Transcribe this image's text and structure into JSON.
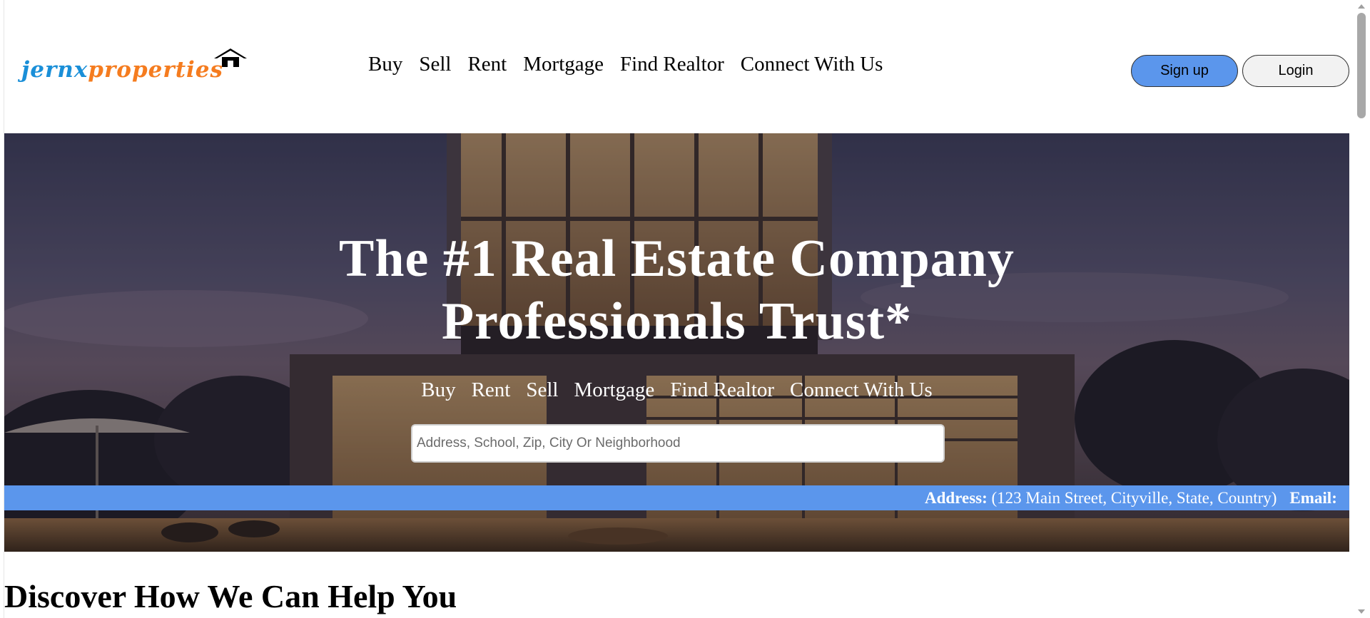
{
  "header": {
    "logo": {
      "part1": "jernx",
      "part2": "properties"
    },
    "nav": [
      "Buy",
      "Sell",
      "Rent",
      "Mortgage",
      "Find Realtor",
      "Connect With Us"
    ],
    "signup_label": "Sign up",
    "login_label": "Login"
  },
  "hero": {
    "title_line1": "The #1 Real Estate Company",
    "title_line2": "Professionals Trust*",
    "nav": [
      "Buy",
      "Rent",
      "Sell",
      "Mortgage",
      "Find Realtor",
      "Connect With Us"
    ],
    "search_placeholder": "Address, School, Zip, City Or Neighborhood",
    "ticker": {
      "address_label": "Address:",
      "address_value": "(123 Main Street, Cityville, State, Country)",
      "email_label": "Email:"
    }
  },
  "section": {
    "title": "Discover How We Can Help You"
  },
  "colors": {
    "accent": "#5b96ec",
    "logo_blue": "#1a8fd8",
    "logo_orange": "#f57c1f"
  },
  "icons": {
    "logo_house": "house-icon"
  }
}
